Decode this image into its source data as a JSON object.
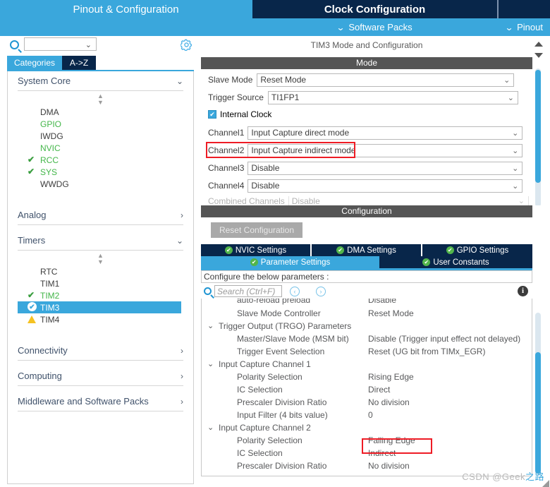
{
  "topbar": {
    "tabs": [
      {
        "label": "Pinout & Configuration",
        "active": false
      },
      {
        "label": "Clock Configuration",
        "active": true
      }
    ],
    "software_packs": "Software Packs",
    "pinout": "Pinout",
    "chevron": "⌄",
    "colors": {
      "light_blue": "#3aa7dc",
      "dark_navy": "#08264a"
    }
  },
  "sidebar": {
    "search_placeholder": "",
    "search_value": "",
    "search_icon": "search-icon",
    "gear_icon": "gear-icon",
    "tabs": [
      {
        "label": "Categories",
        "active": true
      },
      {
        "label": "A->Z",
        "active": false
      }
    ],
    "groups": [
      {
        "title": "System Core",
        "expanded": true,
        "items": [
          {
            "label": "DMA",
            "state": "none"
          },
          {
            "label": "GPIO",
            "state": "green"
          },
          {
            "label": "IWDG",
            "state": "none"
          },
          {
            "label": "NVIC",
            "state": "green"
          },
          {
            "label": "RCC",
            "state": "check"
          },
          {
            "label": "SYS",
            "state": "check"
          },
          {
            "label": "WWDG",
            "state": "none"
          }
        ]
      },
      {
        "title": "Analog",
        "expanded": false,
        "items": []
      },
      {
        "title": "Timers",
        "expanded": true,
        "items": [
          {
            "label": "RTC",
            "state": "none"
          },
          {
            "label": "TIM1",
            "state": "none"
          },
          {
            "label": "TIM2",
            "state": "check"
          },
          {
            "label": "TIM3",
            "state": "selected"
          },
          {
            "label": "TIM4",
            "state": "warn"
          }
        ]
      },
      {
        "title": "Connectivity",
        "expanded": false,
        "items": []
      },
      {
        "title": "Computing",
        "expanded": false,
        "items": []
      },
      {
        "title": "Middleware and Software Packs",
        "expanded": false,
        "items": []
      }
    ]
  },
  "mode": {
    "panel_title": "TIM3 Mode and Configuration",
    "band_label": "Mode",
    "rows": [
      {
        "label": "Slave Mode",
        "value": "Reset Mode"
      },
      {
        "label": "Trigger Source",
        "value": "TI1FP1"
      }
    ],
    "internal_clock": {
      "label": "Internal Clock",
      "checked": true,
      "check_glyph": "✔"
    },
    "channels": [
      {
        "label": "Channel1",
        "value": "Input Capture direct mode",
        "highlight": false
      },
      {
        "label": "Channel2",
        "value": "Input Capture indirect mode",
        "highlight": true
      },
      {
        "label": "Channel3",
        "value": "Disable",
        "highlight": false
      },
      {
        "label": "Channel4",
        "value": "Disable",
        "highlight": false
      }
    ],
    "combined": {
      "label": "Combined Channels",
      "value": "Disable"
    },
    "caret": "⌄",
    "highlight_color": "#ee1c25"
  },
  "configuration": {
    "band_label": "Configuration",
    "reset_button": "Reset Configuration",
    "tabs_row1": [
      {
        "label": "NVIC Settings",
        "active": false
      },
      {
        "label": "DMA Settings",
        "active": false
      },
      {
        "label": "GPIO Settings",
        "active": false
      }
    ],
    "tabs_row2": [
      {
        "label": "Parameter Settings",
        "active": true
      },
      {
        "label": "User Constants",
        "active": false
      }
    ],
    "ok_glyph": "✔",
    "note": "Configure the below parameters :",
    "search_placeholder": "Search (Ctrl+F)",
    "nav_prev": "‹",
    "nav_next": "›",
    "info_label": "i",
    "parameters": [
      {
        "type": "param",
        "name": "auto-reload preload",
        "value": "Disable",
        "clipped": true
      },
      {
        "type": "param",
        "name": "Slave Mode Controller",
        "value": "Reset Mode"
      },
      {
        "type": "group",
        "name": "Trigger Output (TRGO) Parameters",
        "value": ""
      },
      {
        "type": "param",
        "name": "Master/Slave Mode (MSM bit)",
        "value": "Disable (Trigger input effect not delayed)"
      },
      {
        "type": "param",
        "name": "Trigger Event Selection",
        "value": "Reset (UG bit from TIMx_EGR)"
      },
      {
        "type": "group",
        "name": "Input Capture Channel 1",
        "value": ""
      },
      {
        "type": "param",
        "name": "Polarity Selection",
        "value": "Rising Edge"
      },
      {
        "type": "param",
        "name": "IC Selection",
        "value": "Direct"
      },
      {
        "type": "param",
        "name": "Prescaler Division Ratio",
        "value": "No division"
      },
      {
        "type": "param",
        "name": "Input Filter (4 bits value)",
        "value": "0"
      },
      {
        "type": "group",
        "name": "Input Capture Channel 2",
        "value": ""
      },
      {
        "type": "param",
        "name": "Polarity Selection",
        "value": "Falling Edge",
        "highlight": true
      },
      {
        "type": "param",
        "name": "IC Selection",
        "value": "Indirect"
      },
      {
        "type": "param",
        "name": "Prescaler Division Ratio",
        "value": "No division"
      }
    ],
    "group_chevron": "⌄"
  },
  "watermark": {
    "prefix": "CSDN @Geek",
    "suffix": "之路"
  }
}
